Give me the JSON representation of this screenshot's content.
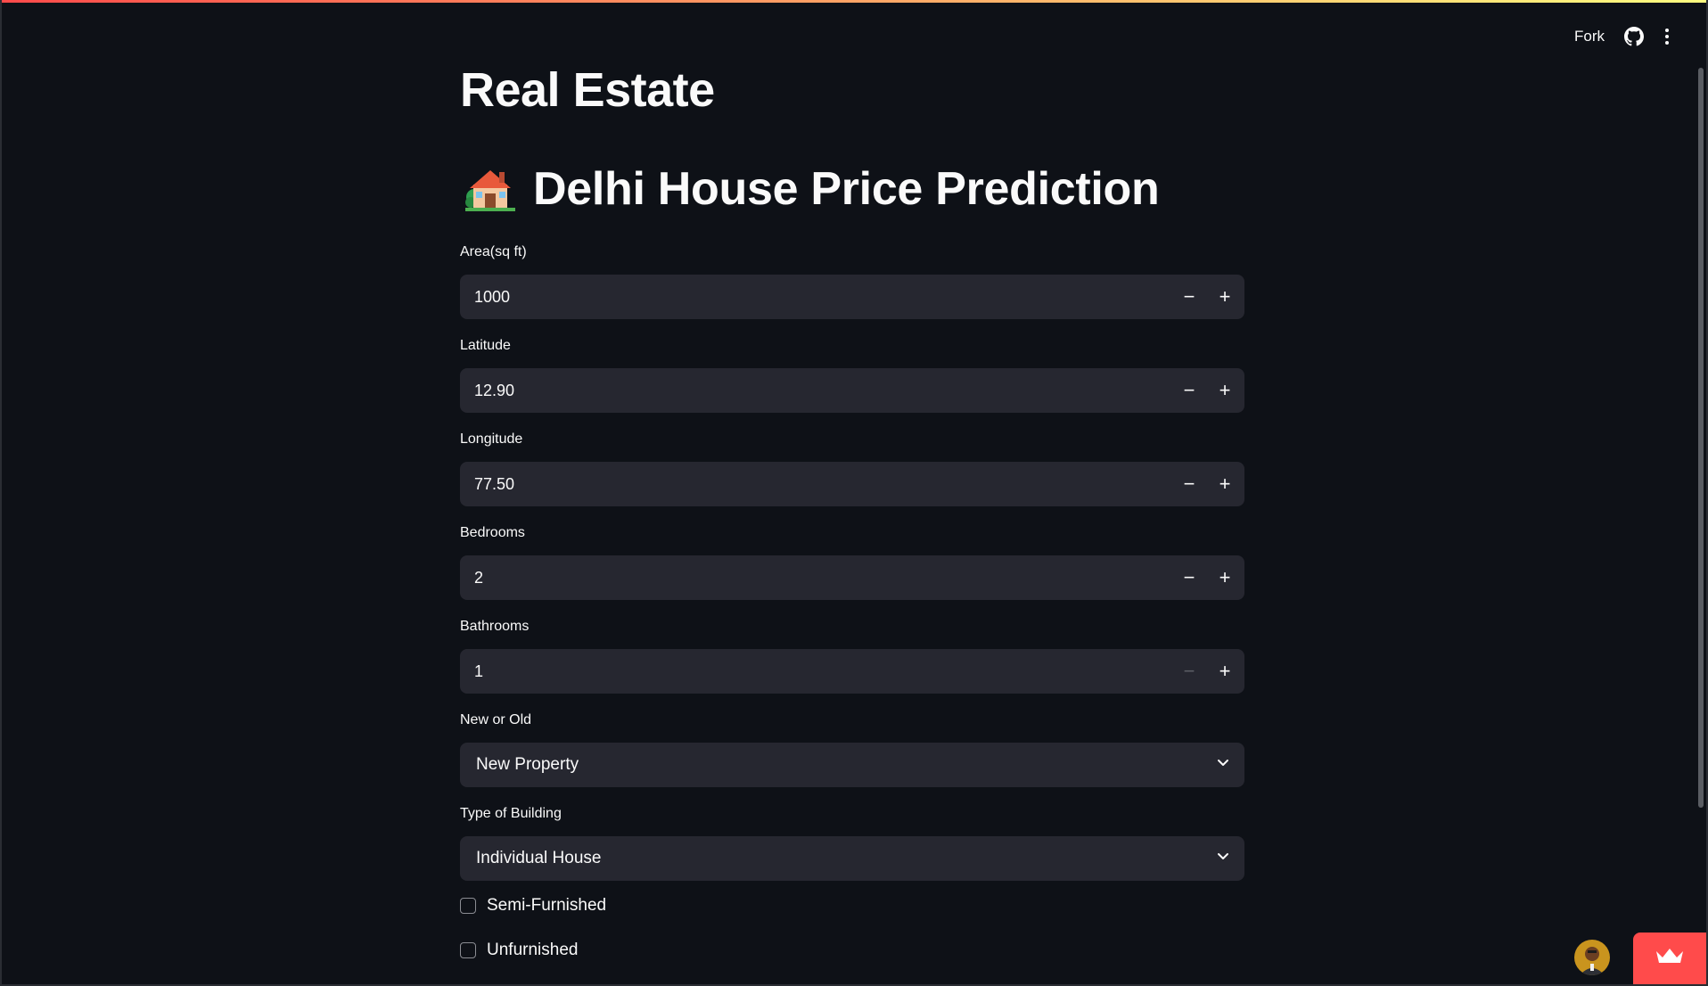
{
  "toolbar": {
    "fork_label": "Fork",
    "github_icon": "github-icon",
    "menu_icon": "more-vertical-icon"
  },
  "main": {
    "title": "Real Estate",
    "subtitle_icon": "house-emoji-icon",
    "subtitle": "Delhi House Price Prediction"
  },
  "fields": {
    "area": {
      "label": "Area(sq ft)",
      "value": "1000"
    },
    "latitude": {
      "label": "Latitude",
      "value": "12.90"
    },
    "longitude": {
      "label": "Longitude",
      "value": "77.50"
    },
    "bedrooms": {
      "label": "Bedrooms",
      "value": "2"
    },
    "bathrooms": {
      "label": "Bathrooms",
      "value": "1"
    }
  },
  "selects": {
    "new_or_old": {
      "label": "New or Old",
      "value": "New Property"
    },
    "building_type": {
      "label": "Type of Building",
      "value": "Individual House"
    }
  },
  "checkboxes": {
    "semi_furnished": {
      "label": "Semi-Furnished",
      "checked": false
    },
    "unfurnished": {
      "label": "Unfurnished",
      "checked": false
    }
  },
  "colors": {
    "background": "#0e1117",
    "input_bg": "#262730",
    "accent": "#ff4b4b"
  }
}
